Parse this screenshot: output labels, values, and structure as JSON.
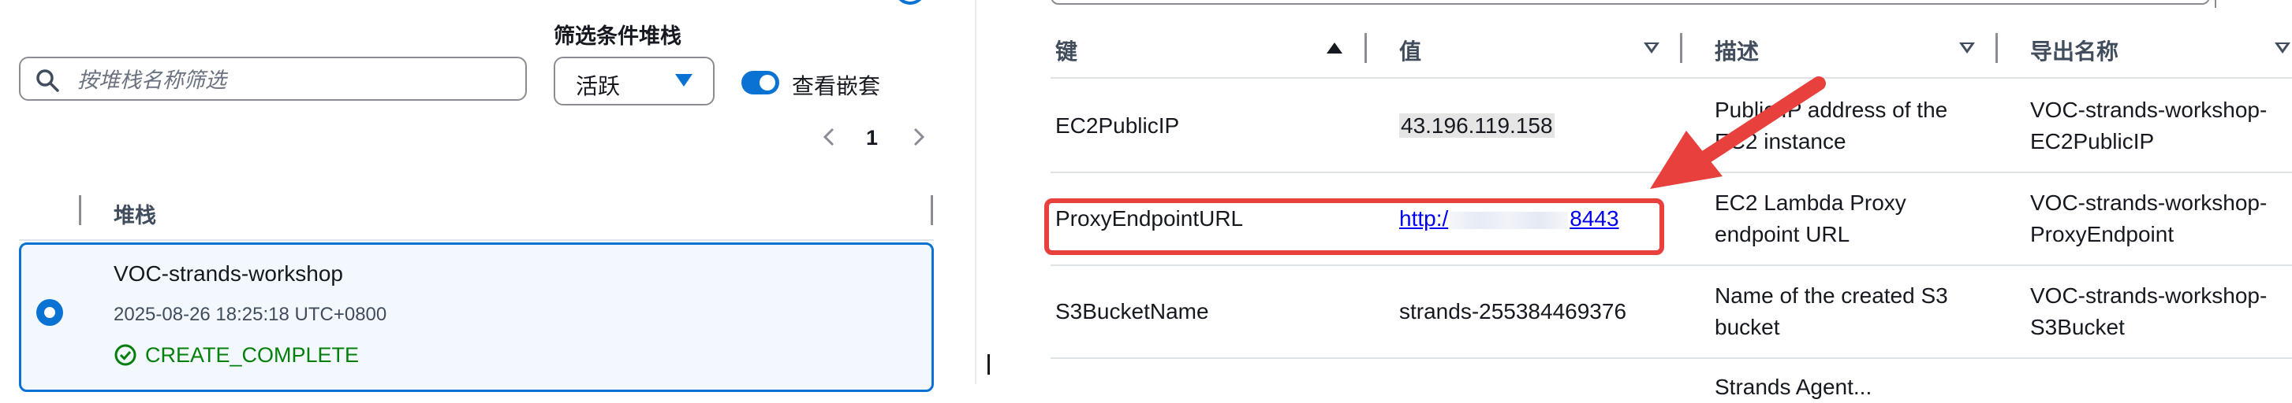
{
  "left": {
    "filter_label": "筛选条件堆栈",
    "search_placeholder": "按堆栈名称筛选",
    "status_filter_value": "活跃",
    "nested_toggle_label": "查看嵌套",
    "page_number": "1",
    "column_header": "堆栈",
    "stack": {
      "name": "VOC-strands-workshop",
      "timestamp": "2025-08-26 18:25:18 UTC+0800",
      "status": "CREATE_COMPLETE"
    }
  },
  "right": {
    "headers": {
      "key": "键",
      "value": "值",
      "description": "描述",
      "export_name": "导出名称"
    },
    "rows": [
      {
        "key": "EC2PublicIP",
        "value": "43.196.119.158",
        "desc_line1": "Public IP address of the",
        "desc_line2": "EC2 instance",
        "export_line1": "VOC-strands-workshop-",
        "export_line2": "EC2PublicIP"
      },
      {
        "key": "ProxyEndpointURL",
        "value_prefix": "http:/",
        "value_suffix": "8443",
        "desc_line1": "EC2 Lambda Proxy",
        "desc_line2": "endpoint URL",
        "export_line1": "VOC-strands-workshop-",
        "export_line2": "ProxyEndpoint"
      },
      {
        "key": "S3BucketName",
        "value": "strands-255384469376",
        "desc_line1": "Name of the created S3",
        "desc_line2": "bucket",
        "export_line1": "VOC-strands-workshop-",
        "export_line2": "S3Bucket"
      },
      {
        "desc_line1": "Strands Agent..."
      }
    ]
  },
  "colors": {
    "accent": "#0972d3",
    "success": "#037f0c",
    "annotation_red": "#e8403c",
    "link": "#0000ee"
  },
  "icons": {
    "search": "search-icon",
    "caret": "caret-down-icon",
    "pager_prev": "chevron-left-icon",
    "pager_next": "chevron-right-icon",
    "status": "check-circle-icon",
    "sort_asc": "sort-ascending-icon",
    "sort_desc": "sort-descending-icon",
    "annotation": "red-arrow-icon"
  }
}
